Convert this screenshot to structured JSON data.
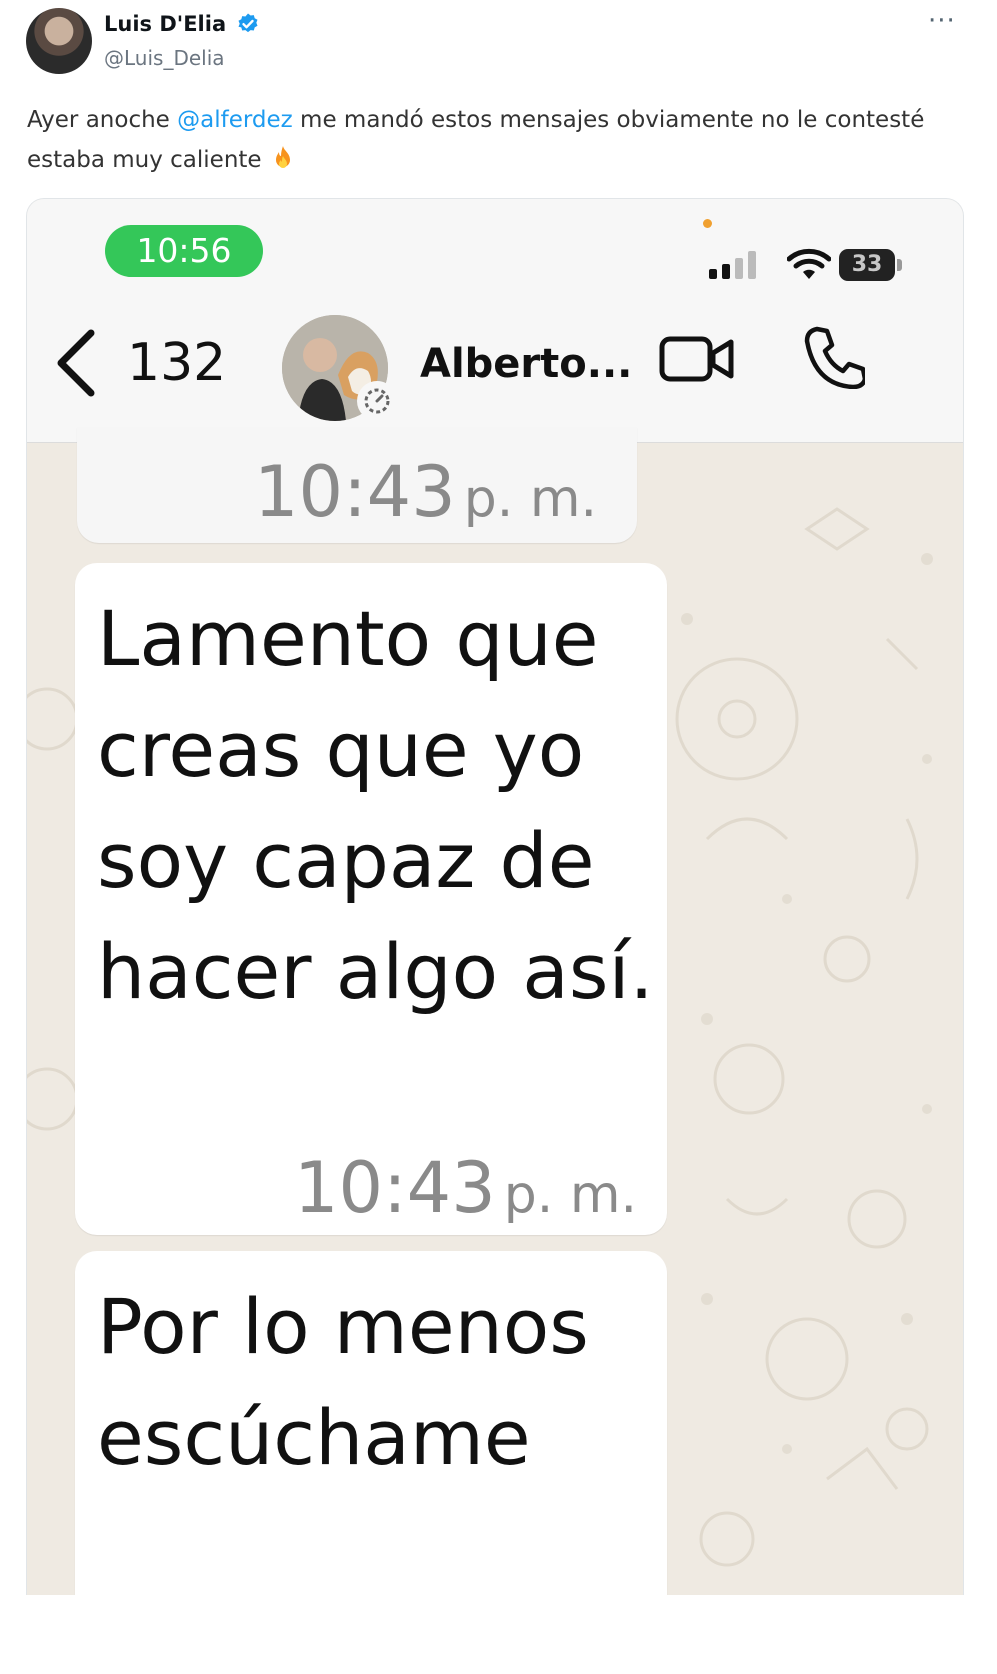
{
  "tweet": {
    "author": {
      "name": "Luis D'Elia",
      "handle": "@Luis_Delia",
      "verified": true
    },
    "more_label": "···",
    "text_before_mention": "Ayer anoche ",
    "mention": "@alferdez",
    "text_after_mention": " me mandó estos mensajes obviamente no le contesté estaba muy caliente",
    "emoji": "fire-emoji"
  },
  "screenshot": {
    "status_bar": {
      "time": "10:56",
      "battery": "33"
    },
    "chat_header": {
      "back_count": "132",
      "contact_name": "Alberto..."
    },
    "messages": [
      {
        "text": "",
        "time": "10:43",
        "time_suffix": "p. m."
      },
      {
        "text": "Lamento que creas que yo soy capaz de hacer algo así.",
        "time": "10:43",
        "time_suffix": "p. m."
      },
      {
        "text": "Por lo menos escúchame",
        "time": "",
        "time_suffix": ""
      }
    ],
    "colors": {
      "status_pill": "#34c759",
      "chat_background": "#efeae2",
      "bubble": "#ffffff",
      "mention": "#1d9bf0"
    }
  }
}
